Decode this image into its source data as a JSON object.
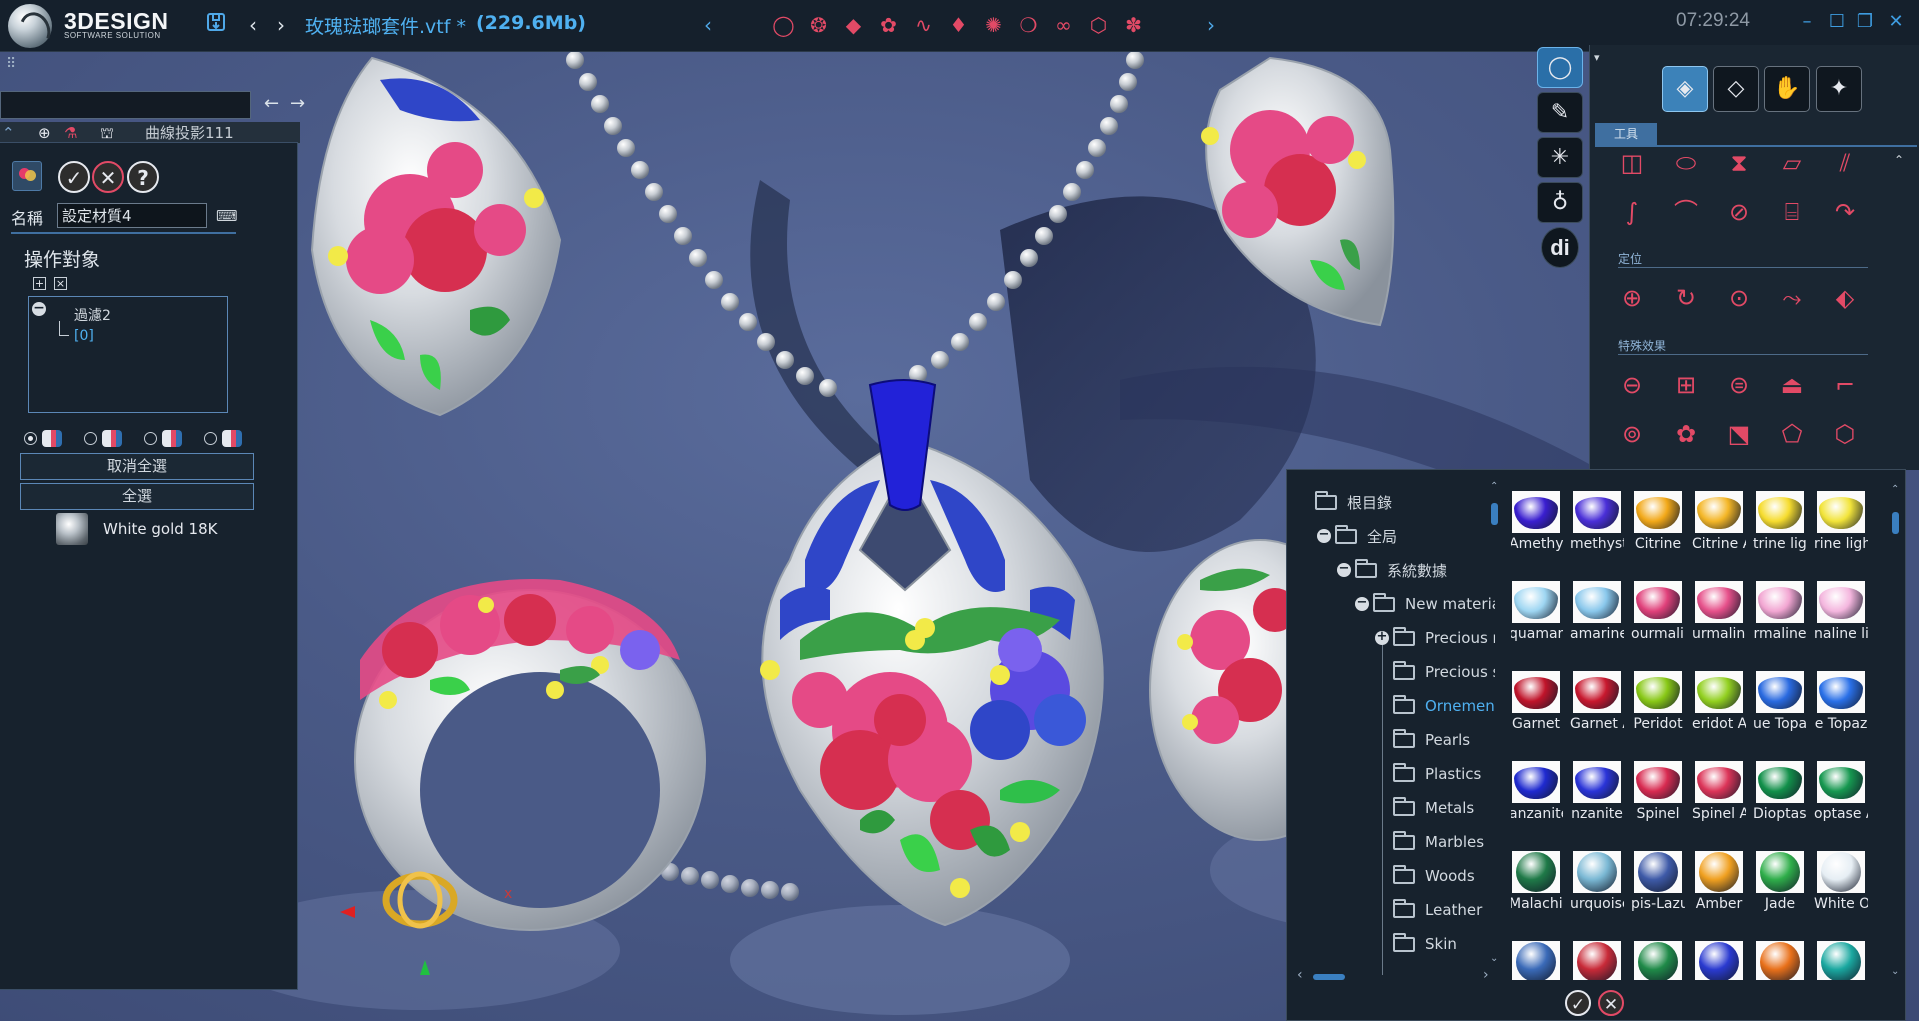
{
  "app": {
    "brand": "3DESIGN",
    "brand_subtitle": "SOFTWARE SOLUTION",
    "file_title": "玫瑰琺瑯套件.vtf *",
    "file_size": "(229.6Mb)",
    "clock": "07:29:24"
  },
  "titlebar": {
    "save_icon": "save-icon",
    "back_icon": "chevron-left-icon",
    "forward_icon": "chevron-right-icon",
    "strip_left": "‹",
    "strip_right": "›",
    "tools": [
      "ring-tool",
      "bend-tool",
      "gem-tool",
      "material-tool",
      "wire-tool",
      "drop-tool",
      "pave-tool",
      "ring-size-tool",
      "link-tool",
      "cube-tool",
      "cluster-tool"
    ],
    "tool_glyphs": [
      "◯",
      "❂",
      "◆",
      "✿",
      "∿",
      "♦",
      "✺",
      "❍",
      "∞",
      "⬡",
      "✽"
    ],
    "win_minimize": "–",
    "win_maximize": "☐",
    "win_restore": "❐",
    "win_close": "✕"
  },
  "left": {
    "menu_glyph": "⠿",
    "nav_back": "←",
    "nav_forward": "→",
    "path_value": "",
    "curve_tab_label": "曲線投影111"
  },
  "material_panel": {
    "ok_glyph": "✓",
    "cancel_glyph": "✕",
    "help_glyph": "?",
    "name_label": "名稱",
    "name_value": "設定材質4",
    "section_title": "操作對象",
    "add_glyph": "+",
    "remove_glyph": "×",
    "tree_root": "過濾2",
    "tree_child": "[0]",
    "deselect_all": "取消全選",
    "select_all": "全選",
    "material_name": "White gold 18K"
  },
  "rail": {
    "buttons": [
      "ring-icon",
      "pen-icon",
      "mesh-icon",
      "pendant-icon",
      "di-icon"
    ],
    "glyphs": [
      "◯",
      "✎",
      "✳",
      "♁",
      "di"
    ]
  },
  "tools_panel": {
    "caret": "▾",
    "categories": [
      "shapes-icon",
      "gem-icon",
      "hand-icon",
      "diamond-icon"
    ],
    "category_glyphs": [
      "◈",
      "◇",
      "✋",
      "✦"
    ],
    "tab_label": "工具",
    "section_positioning": "定位",
    "section_effects": "特殊效果",
    "row1": [
      "◫",
      "⬭",
      "⧗",
      "▱",
      "⫽"
    ],
    "row2": [
      "∫",
      "⌒",
      "⊘",
      "⌸",
      "↷"
    ],
    "row3": [
      "⊕",
      "↻",
      "⊙",
      "⤳",
      "⬖"
    ],
    "row4": [
      "⊖",
      "⊞",
      "⊜",
      "⏏",
      "⌐"
    ],
    "row5": [
      "⊚",
      "✿",
      "⬔",
      "⬠",
      "⬡"
    ],
    "scroll_up": "⌃"
  },
  "browser": {
    "folders": [
      {
        "label": "根目錄",
        "indent": 0
      },
      {
        "label": "全局",
        "indent": 1
      },
      {
        "label": "系統數據",
        "indent": 2
      },
      {
        "label": "New materials",
        "indent": 3
      },
      {
        "label": "Precious m",
        "indent": 4
      },
      {
        "label": "Precious s",
        "indent": 4
      },
      {
        "label": "Ornementa",
        "indent": 4
      },
      {
        "label": "Pearls",
        "indent": 4
      },
      {
        "label": "Plastics",
        "indent": 4
      },
      {
        "label": "Metals",
        "indent": 4
      },
      {
        "label": "Marbles",
        "indent": 4
      },
      {
        "label": "Woods",
        "indent": 4
      },
      {
        "label": "Leather",
        "indent": 4
      },
      {
        "label": "Skin",
        "indent": 4
      }
    ],
    "materials": [
      {
        "label": "Amethyst",
        "color": "#3a1fd0",
        "shape": "stone"
      },
      {
        "label": "methyst A",
        "color": "#4a2fd8",
        "shape": "stone"
      },
      {
        "label": "Citrine",
        "color": "#f2a818",
        "shape": "stone"
      },
      {
        "label": "Citrine Al",
        "color": "#f4b626",
        "shape": "stone"
      },
      {
        "label": "trine ligh",
        "color": "#f6dc2e",
        "shape": "stone"
      },
      {
        "label": "rine light",
        "color": "#f2e43a",
        "shape": "stone"
      },
      {
        "label": "quamarin",
        "color": "#9ed6f2",
        "shape": "stone"
      },
      {
        "label": "amarine",
        "color": "#8ac8ec",
        "shape": "stone"
      },
      {
        "label": "ourmalin",
        "color": "#e0407a",
        "shape": "stone"
      },
      {
        "label": "urmaline",
        "color": "#e6508a",
        "shape": "stone"
      },
      {
        "label": "rmaline",
        "color": "#f2a6d2",
        "shape": "stone"
      },
      {
        "label": "naline lig",
        "color": "#f4b6de",
        "shape": "stone"
      },
      {
        "label": "Garnet",
        "color": "#c0142a",
        "shape": "stone"
      },
      {
        "label": "Garnet Al",
        "color": "#c8182e",
        "shape": "stone"
      },
      {
        "label": "Peridot",
        "color": "#88c816",
        "shape": "stone"
      },
      {
        "label": "eridot Al",
        "color": "#92d020",
        "shape": "stone"
      },
      {
        "label": "ue Topa",
        "color": "#2a6ae0",
        "shape": "stone"
      },
      {
        "label": "e Topaz",
        "color": "#2a70e8",
        "shape": "stone"
      },
      {
        "label": "anzanite",
        "color": "#1f2ad0",
        "shape": "stone"
      },
      {
        "label": "nzanite",
        "color": "#2a34d8",
        "shape": "stone"
      },
      {
        "label": "Spinel",
        "color": "#d82a50",
        "shape": "stone"
      },
      {
        "label": "Spinel Al",
        "color": "#dc3458",
        "shape": "stone"
      },
      {
        "label": "Dioptase",
        "color": "#12904a",
        "shape": "stone"
      },
      {
        "label": "optase A",
        "color": "#169850",
        "shape": "stone"
      },
      {
        "label": "Malachite",
        "color": "#1f7a48",
        "shape": "ball"
      },
      {
        "label": "urquoise",
        "color": "#7ab8d4",
        "shape": "ball"
      },
      {
        "label": "pis-Lazu",
        "color": "#3e5aa8",
        "shape": "ball"
      },
      {
        "label": "Amber",
        "color": "#f0a020",
        "shape": "ball"
      },
      {
        "label": "Jade",
        "color": "#2fae4a",
        "shape": "ball"
      },
      {
        "label": "White Opa",
        "color": "#e6eef4",
        "shape": "ball"
      },
      {
        "label": "",
        "color": "#3a6ab8",
        "shape": "ball"
      },
      {
        "label": "",
        "color": "#c82a38",
        "shape": "ball"
      },
      {
        "label": "",
        "color": "#1f8a48",
        "shape": "ball"
      },
      {
        "label": "",
        "color": "#2a3ad0",
        "shape": "ball"
      },
      {
        "label": "",
        "color": "#e8701a",
        "shape": "ball"
      },
      {
        "label": "",
        "color": "#1aa8a0",
        "shape": "ball"
      }
    ],
    "scroll_left": "‹",
    "scroll_right": "›",
    "scroll_up": "⌃",
    "scroll_down": "⌄",
    "ok_glyph": "✓",
    "cancel_glyph": "✕"
  },
  "colors": {
    "accent": "#4fb0f0",
    "enamel_pink": "#e54a86",
    "enamel_red": "#d62f50",
    "enamel_blue": "#2f46c8",
    "enamel_green": "#3aa048",
    "enamel_yellow": "#f2ea48",
    "silver": "#d7dbe0"
  }
}
